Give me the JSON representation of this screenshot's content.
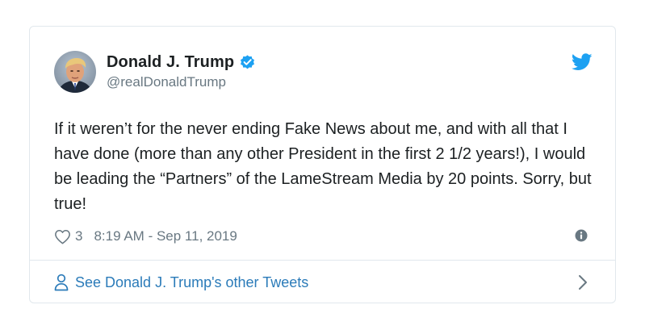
{
  "tweet": {
    "author": {
      "name": "Donald J. Trump",
      "handle": "@realDonaldTrump",
      "verified": true,
      "avatar_icon": "profile-photo"
    },
    "text": "If it weren’t for the never ending Fake News about me, and with all that I have done (more than any other President in the first 2 1/2 years!), I would be leading the “Partners” of the LameStream Media by 20 points. Sorry, but true!",
    "likes": "3",
    "timestamp": "8:19 AM - Sep 11, 2019",
    "footer_link": "See Donald J. Trump's other Tweets"
  },
  "icons": {
    "brand": "twitter-bird-icon",
    "verified": "verified-badge-icon",
    "like": "heart-icon",
    "info": "info-icon",
    "profile": "person-icon",
    "chevron": "chevron-right-icon"
  },
  "colors": {
    "brand": "#1da1f2",
    "link": "#2b7bb9",
    "text": "#1c2022",
    "muted": "#697882",
    "border": "#e1e8ed",
    "verified": "#1da1f2"
  }
}
